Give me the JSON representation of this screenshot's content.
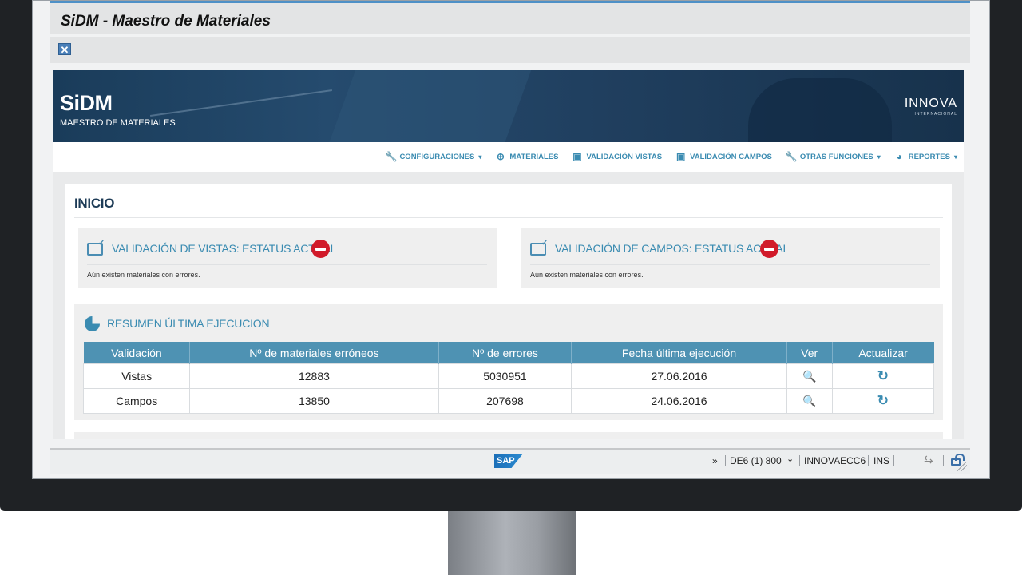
{
  "window": {
    "title": "SiDM - Maestro de Materiales",
    "close_icon": "✕"
  },
  "banner": {
    "logo": "SiDM",
    "subtitle": "MAESTRO DE MATERIALES",
    "brand": "INNOVA",
    "brand_sub": "INTERNACIONAL"
  },
  "nav": {
    "items": [
      {
        "label": "CONFIGURACIONES",
        "icon": "wrench-icon",
        "glyph": "🔧",
        "dropdown": true
      },
      {
        "label": "MATERIALES",
        "icon": "plus-circle-icon",
        "glyph": "⊕",
        "dropdown": false
      },
      {
        "label": "VALIDACIÓN VISTAS",
        "icon": "validate-views-icon",
        "glyph": "▣",
        "dropdown": false
      },
      {
        "label": "VALIDACIÓN CAMPOS",
        "icon": "validate-fields-icon",
        "glyph": "▣",
        "dropdown": false
      },
      {
        "label": "OTRAS FUNCIONES",
        "icon": "wrench-icon",
        "glyph": "🔧",
        "dropdown": true
      },
      {
        "label": "REPORTES",
        "icon": "pie-chart-icon",
        "glyph": "◕",
        "dropdown": true
      }
    ],
    "caret": "▾"
  },
  "main": {
    "title": "INICIO",
    "status_cards": [
      {
        "heading": "VALIDACIÓN DE VISTAS: ESTATUS ACTUAL",
        "message": "Aún existen materiales con errores."
      },
      {
        "heading": "VALIDACIÓN DE CAMPOS: ESTATUS ACTUAL",
        "message": "Aún existen materiales con errores."
      }
    ],
    "summary": {
      "heading": "RESUMEN ÚLTIMA EJECUCION",
      "columns": [
        "Validación",
        "Nº de materiales erróneos",
        "Nº de errores",
        "Fecha última ejecución",
        "Ver",
        "Actualizar"
      ],
      "rows": [
        {
          "validacion": "Vistas",
          "materiales": "12883",
          "errores": "5030951",
          "fecha": "27.06.2016"
        },
        {
          "validacion": "Campos",
          "materiales": "13850",
          "errores": "207698",
          "fecha": "24.06.2016"
        }
      ],
      "view_glyph": "🔍",
      "refresh_glyph": "↻"
    }
  },
  "statusbar": {
    "sap_logo": "SAP",
    "chevrons": "»",
    "system": "DE6 (1) 800",
    "dropdown": "⌄",
    "server": "INNOVAECC6",
    "mode": "INS",
    "transfer_glyph": "⇆"
  }
}
